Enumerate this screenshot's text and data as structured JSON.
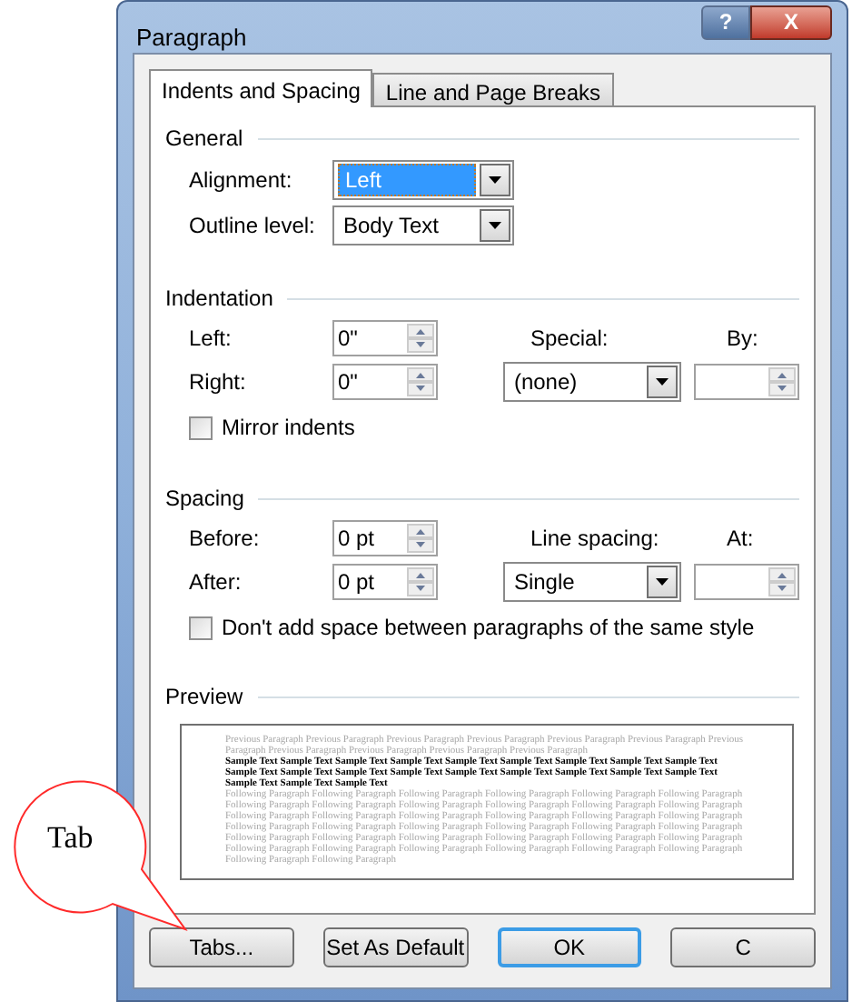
{
  "window": {
    "title": "Paragraph",
    "help": "?",
    "close": "X"
  },
  "tabs": [
    {
      "label": "Indents and Spacing",
      "selected": true
    },
    {
      "label": "Line and Page Breaks",
      "selected": false
    }
  ],
  "general": {
    "heading": "General",
    "alignment": {
      "label": "Alignment:",
      "value": "Left",
      "focused": true
    },
    "outline_level": {
      "label": "Outline level:",
      "value": "Body Text",
      "focused": false
    }
  },
  "indentation": {
    "heading": "Indentation",
    "left": {
      "label": "Left:",
      "value": "0\""
    },
    "right": {
      "label": "Right:",
      "value": "0\""
    },
    "special": {
      "label": "Special:",
      "value": "(none)"
    },
    "by": {
      "label": "By:"
    },
    "mirror_indents": {
      "label": "Mirror indents",
      "checked": false
    }
  },
  "spacing": {
    "heading": "Spacing",
    "before": {
      "label": "Before:",
      "value": "0 pt"
    },
    "after": {
      "label": "After:",
      "value": "0 pt"
    },
    "line_spacing": {
      "label": "Line spacing:",
      "value": "Single"
    },
    "at": {
      "label": "At:"
    },
    "dont_add_space": {
      "label": "Don't add space between paragraphs of the same style",
      "checked": false
    }
  },
  "preview": {
    "heading": "Preview",
    "paragraphs": [
      {
        "kind": "other",
        "text": "Previous Paragraph Previous Paragraph Previous Paragraph Previous Paragraph Previous Paragraph Previous Paragraph Previous Paragraph Previous Paragraph Previous Paragraph Previous Paragraph Previous Paragraph"
      },
      {
        "kind": "sample",
        "text": "Sample Text Sample Text Sample Text Sample Text Sample Text Sample Text Sample Text Sample Text Sample Text Sample Text Sample Text Sample Text Sample Text Sample Text Sample Text Sample Text Sample Text Sample Text Sample Text Sample Text Sample Text"
      },
      {
        "kind": "other",
        "text": "Following Paragraph Following Paragraph Following Paragraph Following Paragraph Following Paragraph Following Paragraph Following Paragraph Following Paragraph Following Paragraph Following Paragraph Following Paragraph Following Paragraph Following Paragraph Following Paragraph Following Paragraph Following Paragraph Following Paragraph Following Paragraph Following Paragraph Following Paragraph Following Paragraph Following Paragraph Following Paragraph Following Paragraph Following Paragraph Following Paragraph Following Paragraph Following Paragraph Following Paragraph Following Paragraph Following Paragraph Following Paragraph Following Paragraph Following Paragraph Following Paragraph Following Paragraph Following Paragraph Following Paragraph"
      }
    ]
  },
  "buttons": [
    {
      "label": "Tabs...",
      "default": false
    },
    {
      "label": "Set As Default",
      "default": false
    },
    {
      "label": "OK",
      "default": true
    },
    {
      "label": "C",
      "default": false
    }
  ],
  "callout": {
    "text": "Tab"
  }
}
